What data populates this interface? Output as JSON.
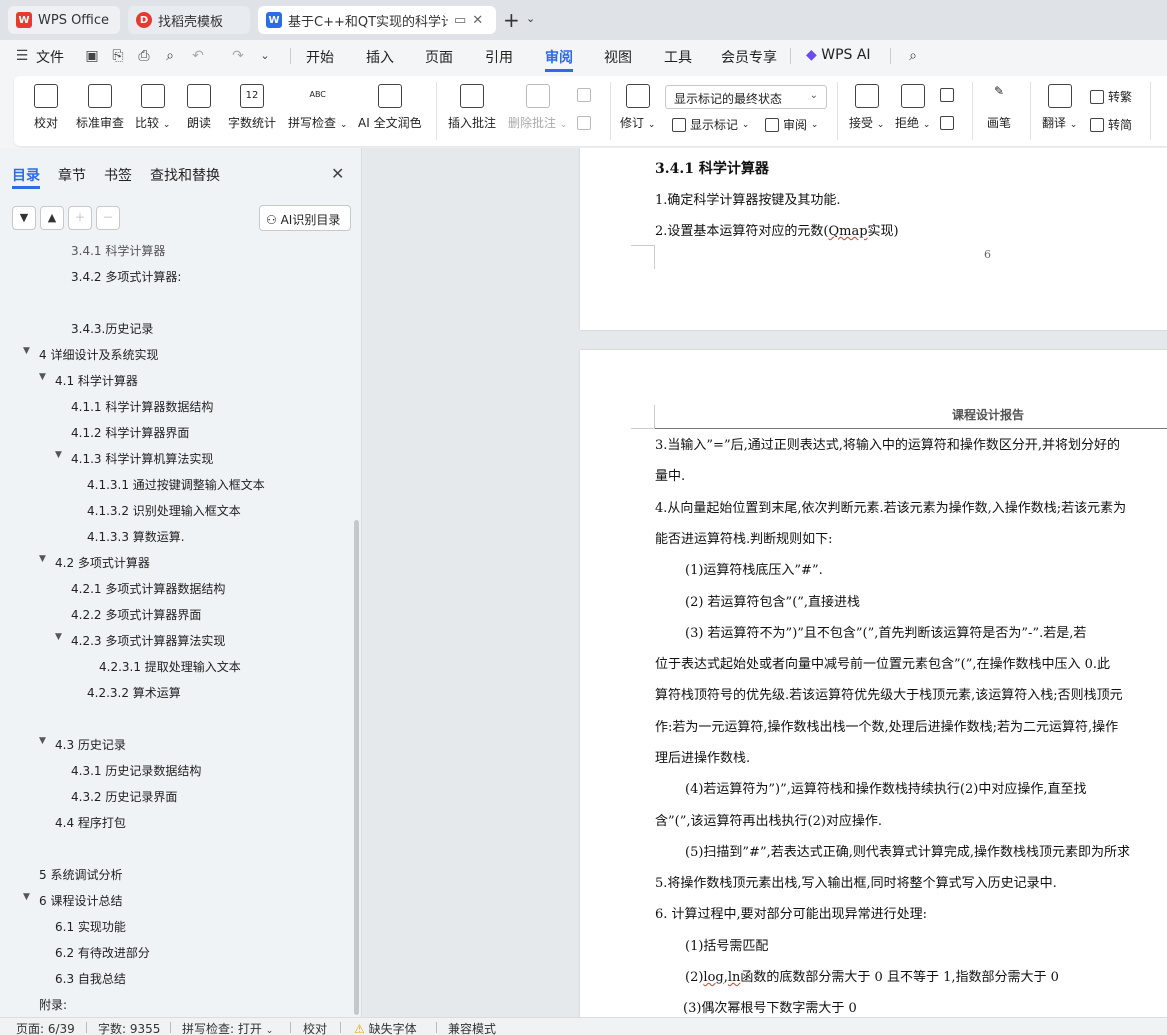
{
  "tabs": [
    {
      "label": "WPS Office"
    },
    {
      "label": "找稻壳模板"
    },
    {
      "label": "基于C++和QT实现的科学计算器"
    }
  ],
  "menu": {
    "file": "文件",
    "items": [
      "开始",
      "插入",
      "页面",
      "引用",
      "审阅",
      "视图",
      "工具",
      "会员专享"
    ],
    "active": "审阅",
    "wps_ai": "WPS AI"
  },
  "ribbon": {
    "proofread": "校对",
    "standard_review": "标准审查",
    "compare": "比较",
    "read_aloud": "朗读",
    "word_count": "字数统计",
    "spell_check": "拼写检查",
    "ai_polish": "AI 全文润色",
    "insert_comment": "插入批注",
    "delete_comment": "删除批注",
    "track_changes": "修订",
    "display_mode": "显示标记的最终状态",
    "show_markup": "显示标记",
    "review": "审阅",
    "accept": "接受",
    "reject": "拒绝",
    "pen": "画笔",
    "translate": "翻译",
    "to_traditional": "转繁",
    "to_simplified": "转简",
    "word_count_icon_text": "12",
    "spell_icon_text": "ABC"
  },
  "nav": {
    "tabs": [
      "目录",
      "章节",
      "书签",
      "查找和替换"
    ],
    "ai_toc": "AI识别目录",
    "toc": [
      {
        "text": "3.4.1  科学计算器",
        "level": 3
      },
      {
        "text": "3.4.2 多项式计算器:",
        "level": 3
      },
      {
        "text": "3.4.3.历史记录",
        "level": 3
      },
      {
        "text": "4 详细设计及系统实现",
        "level": 1
      },
      {
        "text": "4.1 科学计算器",
        "level": 2
      },
      {
        "text": "4.1.1 科学计算器数据结构",
        "level": 3
      },
      {
        "text": "4.1.2 科学计算器界面",
        "level": 3
      },
      {
        "text": "4.1.3 科学计算机算法实现",
        "level": 3
      },
      {
        "text": "4.1.3.1 通过按键调整输入框文本",
        "level": 4
      },
      {
        "text": "4.1.3.2 识别处理输入框文本",
        "level": 4
      },
      {
        "text": "4.1.3.3 算数运算.",
        "level": 4
      },
      {
        "text": "4.2 多项式计算器",
        "level": 2
      },
      {
        "text": "4.2.1 多项式计算器数据结构",
        "level": 3
      },
      {
        "text": "4.2.2 多项式计算器界面",
        "level": 3
      },
      {
        "text": "4.2.3 多项式计算器算法实现",
        "level": 3
      },
      {
        "text": "4.2.3.1   提取处理输入文本",
        "level": 5
      },
      {
        "text": "4.2.3.2 算术运算",
        "level": 4
      },
      {
        "text": "4.3    历史记录",
        "level": 2
      },
      {
        "text": "4.3.1 历史记录数据结构",
        "level": 3
      },
      {
        "text": "4.3.2 历史记录界面",
        "level": 3
      },
      {
        "text": "4.4 程序打包",
        "level": 2
      },
      {
        "text": "5 系统调试分析",
        "level": 1
      },
      {
        "text": "6 课程设计总结",
        "level": 1
      },
      {
        "text": "6.1 实现功能",
        "level": 2
      },
      {
        "text": "6.2 有待改进部分",
        "level": 2
      },
      {
        "text": "6.3 自我总结",
        "level": 2
      },
      {
        "text": "附录:",
        "level": 1
      }
    ]
  },
  "document": {
    "page1": {
      "heading": "3.4.1 科学计算器",
      "line1": "1.确定科学计算器按键及其功能.",
      "line2_pre": "2.设置基本运算符对应的元数(",
      "line2_word": "Qmap",
      "line2_post": "实现)",
      "page_number": "6"
    },
    "page2": {
      "header": "课程设计报告",
      "lines": [
        "3.当输入”=”后,通过正则表达式,将输入中的运算符和操作数区分开,并将划分好的",
        "量中.",
        "4.从向量起始位置到末尾,依次判断元素.若该元素为操作数,入操作数栈;若该元素为",
        "能否进运算符栈.判断规则如下:",
        "(1)运算符栈底压入”#”.",
        "(2)  若运算符包含”(”,直接进栈",
        "(3)  若运算符不为”)”且不包含”(”,首先判断该运算符是否为”-”.若是,若",
        "位于表达式起始处或者向量中减号前一位置元素包含”(”,在操作数栈中压入 0.此",
        "算符栈顶符号的优先级.若该运算符优先级大于栈顶元素,该运算符入栈;否则栈顶元",
        "作:若为一元运算符,操作数栈出栈一个数,处理后进操作数栈;若为二元运算符,操作",
        "理后进操作数栈.",
        "(4)若运算符为”)”,运算符栈和操作数栈持续执行(2)中对应操作,直至找",
        "含”(”,该运算符再出栈执行(2)对应操作.",
        "(5)扫描到”#”,若表达式正确,则代表算式计算完成,操作数栈栈顶元素即为所求",
        "5.将操作数栈顶元素出栈,写入输出框,同时将整个算式写入历史记录中.",
        "6.  计算过程中,要对部分可能出现异常进行处理:",
        "(1)括号需匹配"
      ],
      "line_log_pre": "(2)",
      "line_log_w1": "log",
      "line_log_mid": ",",
      "line_log_w2": "ln",
      "line_log_post": "函数的底数部分需大于 0 且不等于 1,指数部分需大于 0",
      "line_last": "(3)偶次幂根号下数字需大于 0"
    }
  },
  "status": {
    "page": "页面: 6/39",
    "words": "字数: 9355",
    "spell": "拼写检查: 打开",
    "proof": "校对",
    "missing_font": "缺失字体",
    "compat": "兼容模式"
  }
}
